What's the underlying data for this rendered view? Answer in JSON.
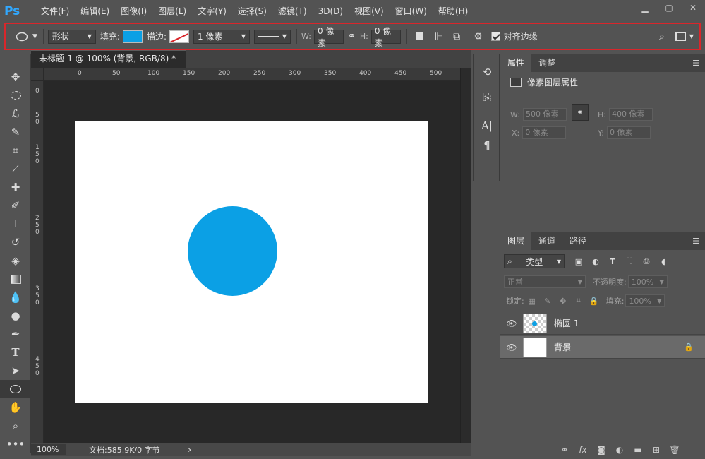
{
  "app": {
    "logo": "Ps",
    "menu": [
      "文件(F)",
      "编辑(E)",
      "图像(I)",
      "图层(L)",
      "文字(Y)",
      "选择(S)",
      "滤镜(T)",
      "3D(D)",
      "视图(V)",
      "窗口(W)",
      "帮助(H)"
    ],
    "window_controls": [
      "minimize-icon",
      "maximize-icon",
      "close-icon"
    ]
  },
  "options": {
    "mode": "形状",
    "fill_label": "填充:",
    "fill_color": "#0ba0e5",
    "stroke_label": "描边:",
    "stroke_width": "1 像素",
    "w_label": "W:",
    "w_value": "0 像素",
    "h_label": "H:",
    "h_value": "0 像素",
    "align_edges": "对齐边缘"
  },
  "document": {
    "tab_title": "未标题-1 @ 100% (背景, RGB/8) *",
    "close_glyph": "×",
    "ruler_h": [
      "0",
      "50",
      "100",
      "150",
      "200",
      "250",
      "300",
      "350",
      "400",
      "450",
      "500"
    ],
    "ruler_v": [
      "0",
      "5",
      "0",
      "1",
      "5",
      "0",
      "2",
      "5",
      "0",
      "3",
      "5",
      "0",
      "4",
      "5",
      "0"
    ],
    "zoom": "100%",
    "doc_info": "文档:585.9K/0 字节",
    "status_arrow": "›"
  },
  "canvas": {
    "background": "#ffffff",
    "shape_color": "#0ba0e5"
  },
  "properties": {
    "tabs": [
      "属性",
      "调整"
    ],
    "title": "像素图层属性",
    "w_label": "W:",
    "w_value": "500 像素",
    "h_label": "H:",
    "h_value": "400 像素",
    "x_label": "X:",
    "x_value": "0 像素",
    "y_label": "Y:",
    "y_value": "0 像素"
  },
  "layers": {
    "tabs": [
      "图层",
      "通道",
      "路径"
    ],
    "filter": "类型",
    "blend_mode": "正常",
    "opacity_label": "不透明度:",
    "opacity_value": "100%",
    "lock_label": "锁定:",
    "fill_label": "填充:",
    "fill_value": "100%",
    "items": [
      {
        "name": "椭圆 1",
        "selected": false
      },
      {
        "name": "背景",
        "selected": true
      }
    ]
  }
}
